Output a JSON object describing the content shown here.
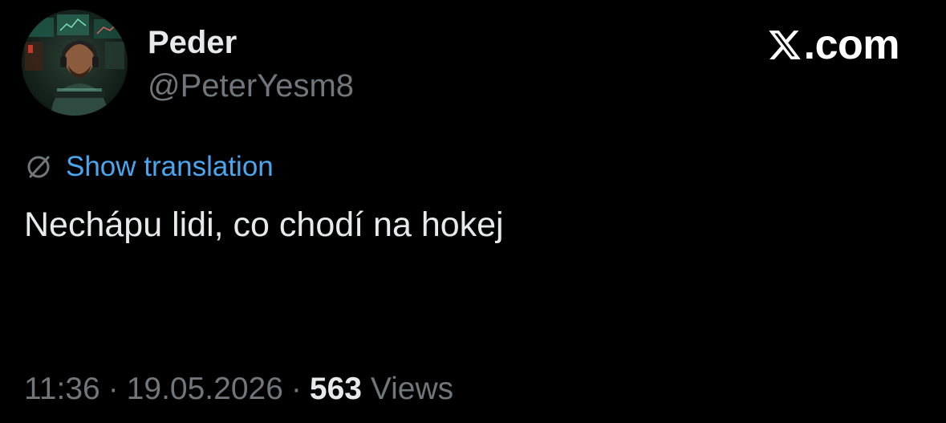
{
  "author": {
    "display_name": "Peder",
    "handle": "@PeterYesm8"
  },
  "brand": {
    "icon": "x-logo-icon",
    "domain_suffix": ".com"
  },
  "translation": {
    "icon": "globe-icon",
    "label": "Show translation"
  },
  "tweet": {
    "text": "Nechápu lidi, co chodí na hokej"
  },
  "meta": {
    "time": "11:36",
    "separator": "·",
    "date": "19.05.2026",
    "views_count": "563",
    "views_label": "Views"
  },
  "colors": {
    "background": "#000000",
    "primary_text": "#e7e9ea",
    "secondary_text": "#71767b",
    "link": "#4aa6ee"
  }
}
